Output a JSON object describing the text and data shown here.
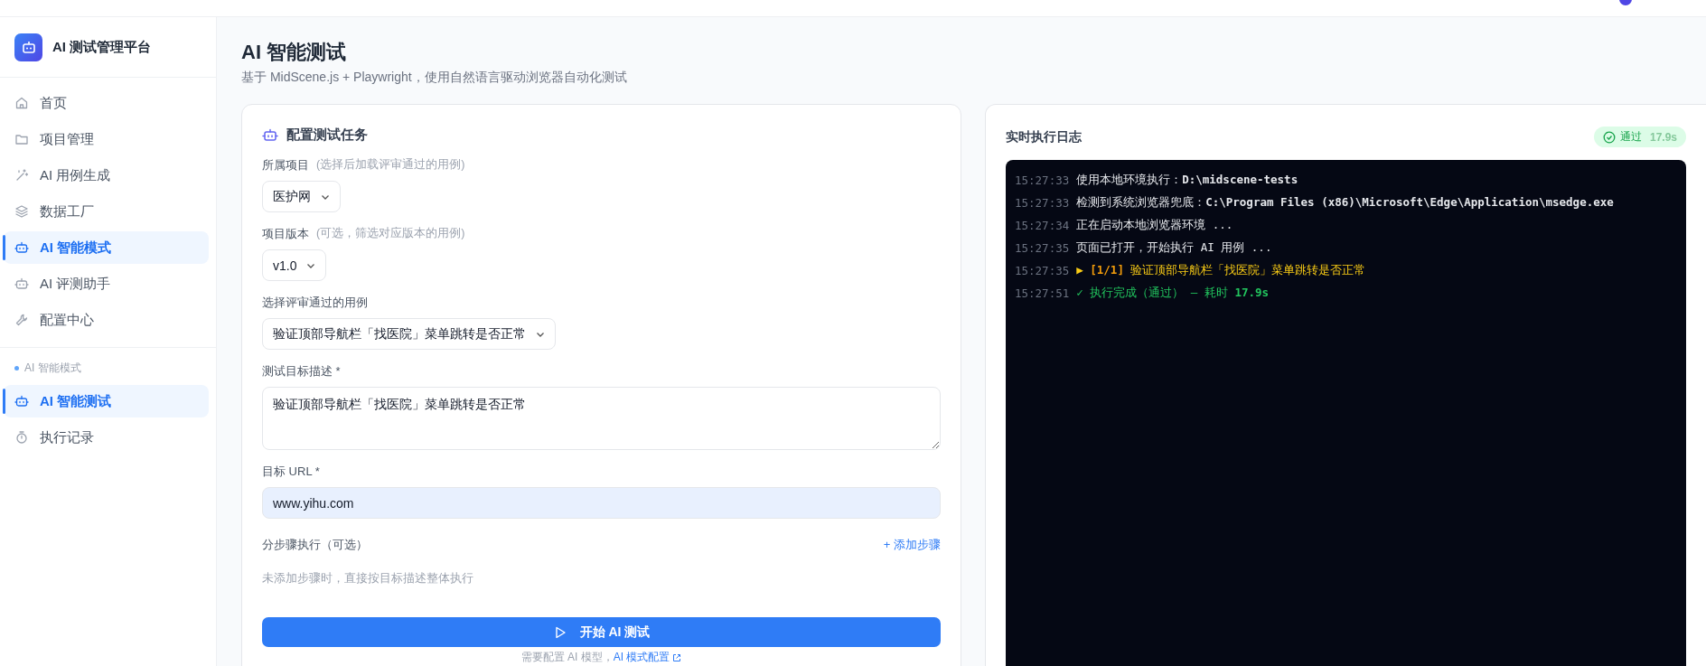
{
  "sidebar": {
    "brand": "AI 测试管理平台",
    "items": [
      {
        "label": "首页",
        "selected": false
      },
      {
        "label": "项目管理",
        "selected": false
      },
      {
        "label": "AI 用例生成",
        "selected": false
      },
      {
        "label": "数据工厂",
        "selected": false
      },
      {
        "label": "AI 智能模式",
        "selected": true
      },
      {
        "label": "AI 评测助手",
        "selected": false
      },
      {
        "label": "配置中心",
        "selected": false
      }
    ],
    "section": {
      "title": "AI 智能模式",
      "items": [
        {
          "label": "AI 智能测试",
          "selected": true
        },
        {
          "label": "执行记录",
          "selected": false
        }
      ]
    }
  },
  "page": {
    "title": "AI 智能测试",
    "subtitle": "基于 MidScene.js + Playwright，使用自然语言驱动浏览器自动化测试"
  },
  "config": {
    "title": "配置测试任务",
    "project": {
      "label": "所属项目",
      "hint": "(选择后加载评审通过的用例)",
      "value": "医护网"
    },
    "version": {
      "label": "项目版本",
      "hint": "(可选，筛选对应版本的用例)",
      "value": "v1.0"
    },
    "case": {
      "label": "选择评审通过的用例",
      "value": "验证顶部导航栏「找医院」菜单跳转是否正常"
    },
    "goal": {
      "label": "测试目标描述 *",
      "value": "验证顶部导航栏「找医院」菜单跳转是否正常"
    },
    "url": {
      "label": "目标 URL *",
      "value": "www.yihu.com"
    },
    "steps": {
      "label": "分步骤执行（可选）",
      "add": "+ 添加步骤",
      "empty": "未添加步骤时，直接按目标描述整体执行"
    },
    "start": "开始 AI 测试",
    "footnote": "需要配置 AI 模型，",
    "footnote_link": "AI 模式配置"
  },
  "log": {
    "title": "实时执行日志",
    "status": {
      "kind": "passed",
      "label": "通过",
      "time": "17.9s"
    },
    "lines": [
      {
        "time": "15:27:33",
        "kind": "info",
        "text": "使用本地环境执行：**D:\\midscene-tests**"
      },
      {
        "time": "15:27:33",
        "kind": "info",
        "text": "检测到系统浏览器兜底：**C:\\Program Files (x86)\\Microsoft\\Edge\\Application\\msedge.exe**"
      },
      {
        "time": "15:27:34",
        "kind": "info",
        "text": "正在启动本地浏览器环境 ..."
      },
      {
        "time": "15:27:35",
        "kind": "info",
        "text": "页面已打开，开始执行 AI 用例 ..."
      },
      {
        "time": "15:27:35",
        "kind": "step",
        "text": "▶ **[1/1]** 验证顶部导航栏「找医院」菜单跳转是否正常"
      },
      {
        "time": "15:27:51",
        "kind": "success",
        "text": "✓ 执行完成（通过） — 耗时 **17.9s**"
      }
    ]
  }
}
